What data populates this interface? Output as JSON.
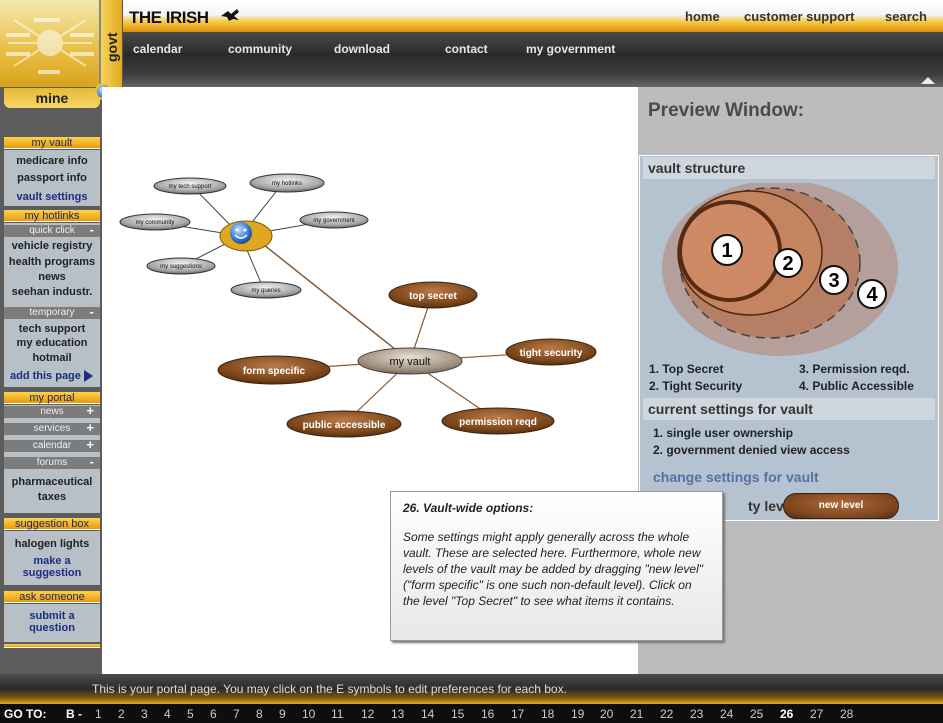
{
  "header": {
    "brand": "THE IRISH",
    "govt_tab": "govt",
    "top_links": [
      "home",
      "customer support",
      "search"
    ],
    "nav": [
      "calendar",
      "community",
      "download",
      "contact",
      "my government"
    ]
  },
  "sidebar": {
    "mine_tab": "mine",
    "my_vault": {
      "title": "my vault",
      "items": [
        "medicare info",
        "passport info",
        "vault settings"
      ]
    },
    "my_hotlinks": {
      "title": "my hotlinks",
      "quick_click": "quick click",
      "quick_items": [
        "vehicle registry",
        "health programs",
        "news",
        "seehan industr."
      ],
      "temporary": "temporary",
      "temp_items": [
        "tech support",
        "my education",
        "hotmail"
      ],
      "add_page": "add this page"
    },
    "my_portal": {
      "title": "my portal",
      "items": [
        "news",
        "services",
        "calendar",
        "forums"
      ],
      "extra": [
        "pharmaceutical",
        "taxes"
      ]
    },
    "suggestion_box": {
      "title": "suggestion box",
      "item": "halogen lights",
      "link": "make a suggestion"
    },
    "ask_someone": {
      "title": "ask someone",
      "link": "submit a question"
    }
  },
  "map": {
    "center_grey": "my vault",
    "hub_nodes": [
      "my tech support",
      "my hotlinks",
      "my community",
      "my government",
      "my suggestions",
      "my queries"
    ],
    "vault_nodes": [
      "top secret",
      "tight security",
      "form specific",
      "public accessible",
      "permission reqd"
    ]
  },
  "preview": {
    "title": "Preview Window:",
    "vault_structure": "vault structure",
    "rings": [
      "1",
      "2",
      "3",
      "4"
    ],
    "legend": [
      "1. Top Secret",
      "2. Tight Security",
      "3. Permission reqd.",
      "4. Public Accessible"
    ],
    "current_settings": "current settings for vault",
    "settings": [
      "1. single user ownership",
      "2. government denied view access"
    ],
    "change_link": "change settings for vault",
    "level_label": "ty level",
    "new_level": "new level"
  },
  "tooltip": {
    "title": "26. Vault-wide options:",
    "body": "Some settings might apply generally across the whole vault. These are selected here. Furthermore, whole new levels of the vault may be added by dragging \"new level\" (\"form specific\" is one such non-default level). Click on the level \"Top Secret\" to see what items it contains."
  },
  "footer": {
    "message": "This is your portal page. You may click on the E symbols to edit preferences for each box.",
    "goto_label": "GO TO:",
    "goto_prefix": "B -",
    "pages": [
      "1",
      "2",
      "3",
      "4",
      "5",
      "6",
      "7",
      "8",
      "9",
      "10",
      "11",
      "12",
      "13",
      "14",
      "15",
      "16",
      "17",
      "18",
      "19",
      "20",
      "21",
      "22",
      "23",
      "24",
      "25",
      "26",
      "27",
      "28"
    ],
    "current_page": "26"
  }
}
